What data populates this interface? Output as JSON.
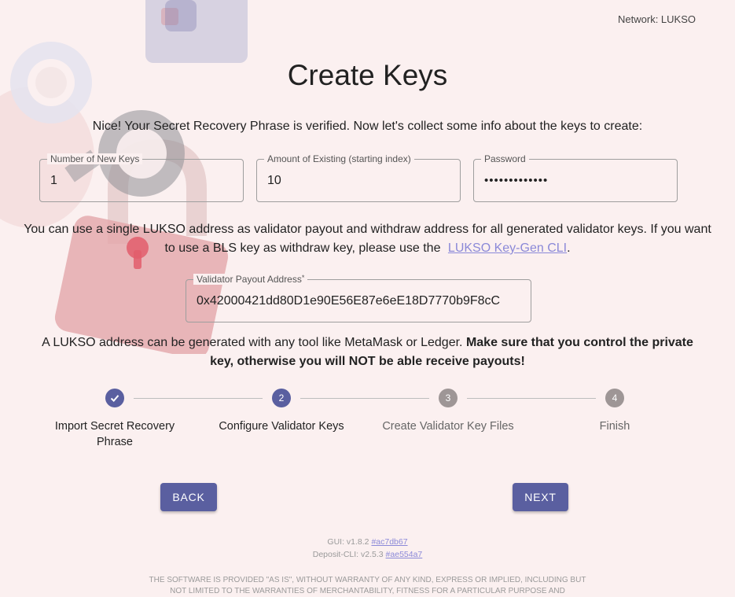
{
  "header": {
    "network": "Network: LUKSO"
  },
  "page": {
    "title": "Create Keys",
    "intro": "Nice! Your Secret Recovery Phrase is verified. Now let's collect some info about the keys to create:"
  },
  "fields": {
    "num_keys": {
      "label": "Number of New Keys",
      "value": "1"
    },
    "existing": {
      "label": "Amount of Existing (starting index)",
      "value": "10"
    },
    "password": {
      "label": "Password",
      "value": "•••••••••••••"
    },
    "payout": {
      "label": "Validator Payout Address",
      "required_mark": "*",
      "value": "0x42000421dd80D1e90E56E87e6eE18D7770b9F8cC"
    }
  },
  "withdraw_info": {
    "line1": "You can use a single LUKSO address as validator payout and withdraw address for all generated validator keys. If you want",
    "line2_prefix": "to use a BLS key as withdraw key, please use the",
    "link": "LUKSO Key-Gen CLI",
    "suffix": "."
  },
  "address_info": {
    "normal": "A LUKSO address can be generated with any tool like MetaMask or Ledger.",
    "bold1": "Make sure that you control the private",
    "bold2": "key, otherwise you will NOT be able receive payouts!"
  },
  "stepper": {
    "steps": [
      {
        "number": "1",
        "icon": "check-icon",
        "label_line1": "Import Secret Recovery",
        "label_line2": "Phrase",
        "state": "completed"
      },
      {
        "number": "2",
        "label_line1": "Configure Validator Keys",
        "state": "active"
      },
      {
        "number": "3",
        "label_line1": "Create Validator Key Files",
        "state": "inactive"
      },
      {
        "number": "4",
        "label_line1": "Finish",
        "state": "inactive"
      }
    ]
  },
  "buttons": {
    "back": "BACK",
    "next": "NEXT"
  },
  "footer": {
    "gui_prefix": "GUI: v1.8.2",
    "gui_hash": "#ac7db67",
    "cli_prefix": "Deposit-CLI: v2.5.3",
    "cli_hash": "#ae554a7",
    "license_line1": "THE SOFTWARE IS PROVIDED \"AS IS\", WITHOUT WARRANTY OF ANY KIND, EXPRESS OR IMPLIED, INCLUDING BUT",
    "license_line2": "NOT LIMITED TO THE WARRANTIES OF MERCHANTABILITY, FITNESS FOR A PARTICULAR PURPOSE AND"
  },
  "colors": {
    "accent": "#5a5fa0",
    "inactive_step": "#9e9696",
    "link": "#8b89d8",
    "background": "#fbf0f0"
  }
}
